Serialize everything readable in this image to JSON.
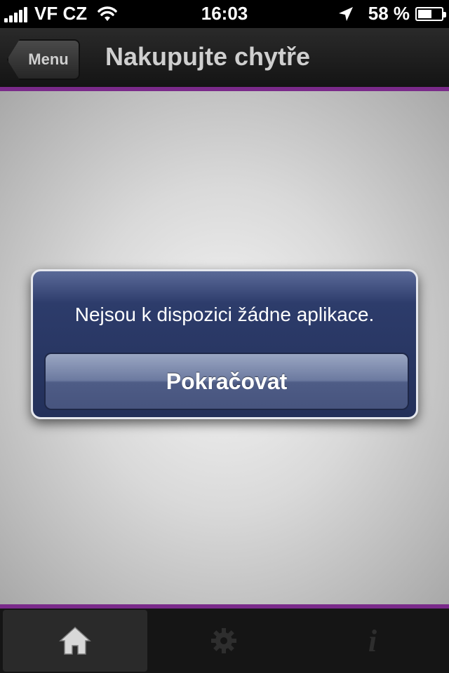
{
  "status_bar": {
    "carrier": "VF CZ",
    "time": "16:03",
    "battery_percent": "58 %",
    "battery_level": 0.58
  },
  "nav_bar": {
    "back_label": "Menu",
    "title": "Nakupujte chytře"
  },
  "alert": {
    "message": "Nejsou k dispozici žádne aplikace.",
    "button_label": "Pokračovat"
  },
  "tab_bar": {
    "tabs": [
      {
        "icon": "home-icon",
        "selected": true
      },
      {
        "icon": "gear-icon",
        "selected": false
      },
      {
        "icon": "info-icon",
        "selected": false
      }
    ]
  },
  "colors": {
    "accent_stripe": "#7a2a8a",
    "alert_background": "#2d3c6b"
  }
}
